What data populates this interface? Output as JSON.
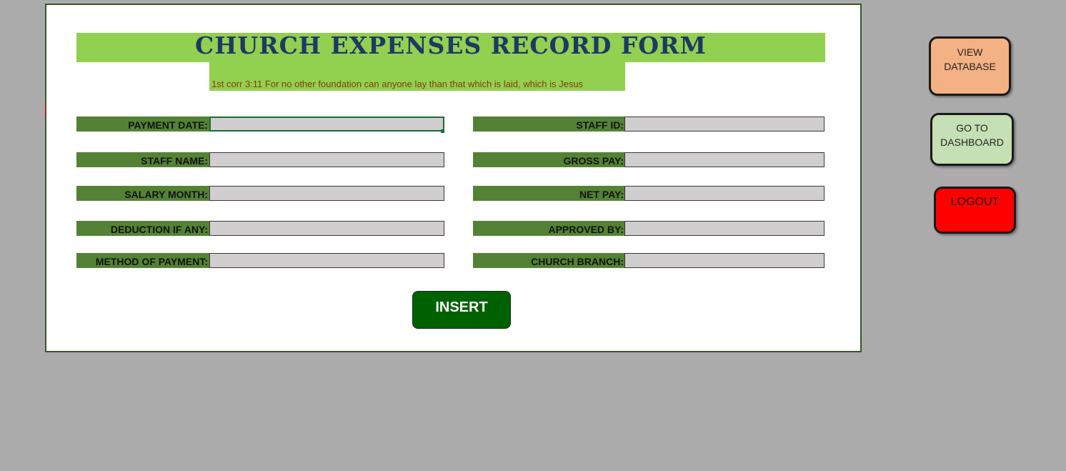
{
  "form": {
    "title": "CHURCH EXPENSES RECORD FORM",
    "verse": "1st corr 3:11 For no other foundation can anyone lay than that which is laid, which is Jesus",
    "left_fields": [
      {
        "label": "PAYMENT DATE:",
        "value": ""
      },
      {
        "label": "STAFF NAME:",
        "value": ""
      },
      {
        "label": "SALARY MONTH:",
        "value": ""
      },
      {
        "label": "DEDUCTION IF ANY:",
        "value": ""
      },
      {
        "label": "METHOD OF PAYMENT:",
        "value": ""
      }
    ],
    "right_fields": [
      {
        "label": "STAFF ID:",
        "value": ""
      },
      {
        "label": "GROSS PAY:",
        "value": ""
      },
      {
        "label": "NET PAY:",
        "value": ""
      },
      {
        "label": "APPROVED BY:",
        "value": ""
      },
      {
        "label": "CHURCH BRANCH:",
        "value": ""
      }
    ],
    "insert_label": "INSERT"
  },
  "side_buttons": {
    "view_database": {
      "line1": "VIEW",
      "line2": "DATABASE"
    },
    "go_to_dashboard": {
      "line1": "GO TO",
      "line2": "DASHBOARD"
    },
    "logout": "LOGOUT"
  },
  "colors": {
    "title_bar": "#92d050",
    "title_text": "#1f3864",
    "label_bg": "#548235",
    "field_bg": "#d0cece",
    "insert_bg": "#006100",
    "view_bg": "#f4b183",
    "dash_bg": "#c5e0b4",
    "logout_bg": "#ff0000",
    "sheet_bg": "#ababab"
  }
}
